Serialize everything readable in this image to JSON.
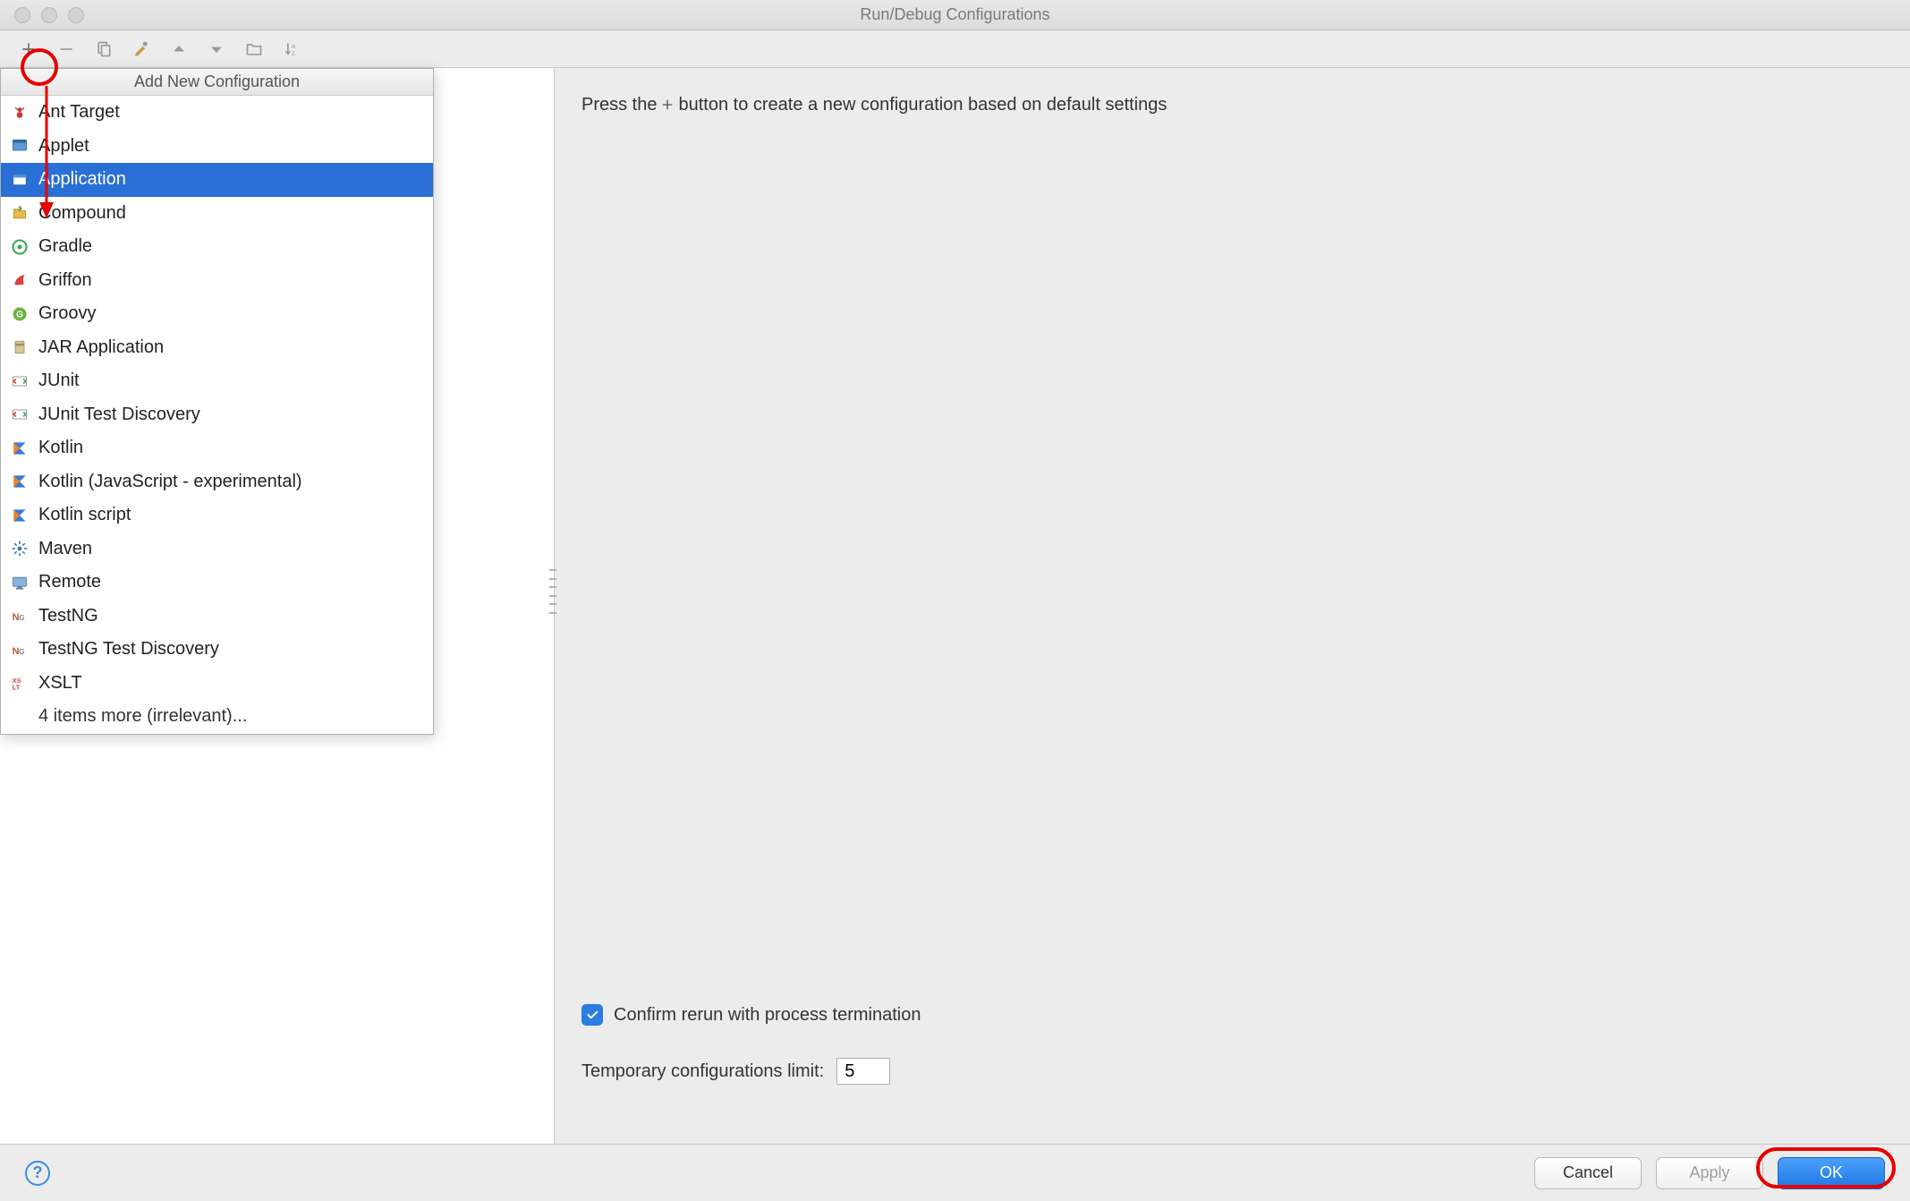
{
  "title": "Run/Debug Configurations",
  "toolbar": {
    "add": "+",
    "remove": "−"
  },
  "popup": {
    "header": "Add New Configuration",
    "items": [
      {
        "label": "Ant Target",
        "icon": "ant"
      },
      {
        "label": "Applet",
        "icon": "applet"
      },
      {
        "label": "Application",
        "icon": "application",
        "selected": true
      },
      {
        "label": "Compound",
        "icon": "compound"
      },
      {
        "label": "Gradle",
        "icon": "gradle"
      },
      {
        "label": "Griffon",
        "icon": "griffon"
      },
      {
        "label": "Groovy",
        "icon": "groovy"
      },
      {
        "label": "JAR Application",
        "icon": "jar"
      },
      {
        "label": "JUnit",
        "icon": "junit"
      },
      {
        "label": "JUnit Test Discovery",
        "icon": "junit"
      },
      {
        "label": "Kotlin",
        "icon": "kotlin"
      },
      {
        "label": "Kotlin (JavaScript - experimental)",
        "icon": "kotlin"
      },
      {
        "label": "Kotlin script",
        "icon": "kotlin"
      },
      {
        "label": "Maven",
        "icon": "maven"
      },
      {
        "label": "Remote",
        "icon": "remote"
      },
      {
        "label": "TestNG",
        "icon": "testng"
      },
      {
        "label": "TestNG Test Discovery",
        "icon": "testng"
      },
      {
        "label": "XSLT",
        "icon": "xslt"
      }
    ],
    "more": "4 items more (irrelevant)..."
  },
  "content": {
    "hint_pre": "Press the",
    "hint_post": " button to create a new configuration based on default settings",
    "confirm_label": "Confirm rerun with process termination",
    "confirm_checked": true,
    "limit_label": "Temporary configurations limit:",
    "limit_value": "5"
  },
  "footer": {
    "cancel": "Cancel",
    "apply": "Apply",
    "ok": "OK"
  }
}
